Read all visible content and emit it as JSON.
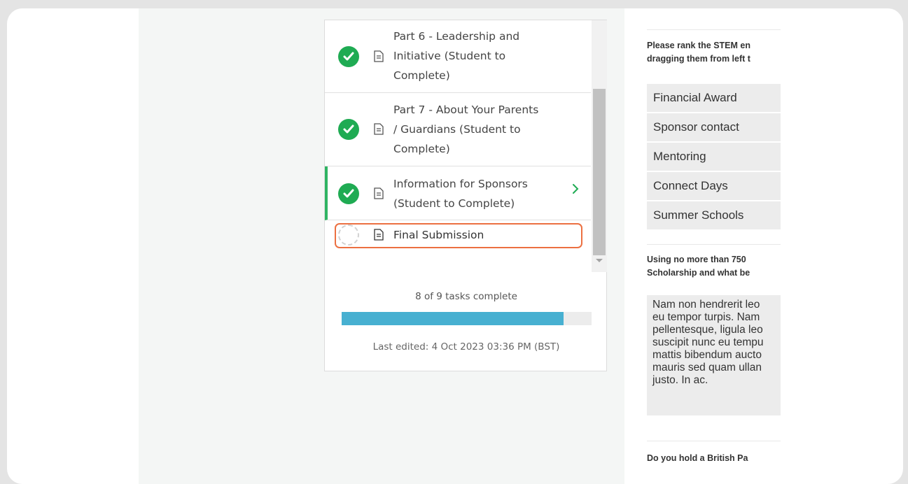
{
  "tasks": [
    {
      "label_lines": [
        "Part 6 - Leadership and",
        "Initiative (Student to",
        "Complete)"
      ],
      "status": "complete"
    },
    {
      "label_lines": [
        "Part 7 - About Your Parents",
        "/ Guardians (Student to",
        "Complete)"
      ],
      "status": "complete"
    },
    {
      "label_lines": [
        "Information for Sponsors",
        "(Student to Complete)"
      ],
      "status": "complete",
      "active": true
    },
    {
      "label_lines": [
        "Final Submission"
      ],
      "status": "pending",
      "highlighted": true
    }
  ],
  "progress": {
    "text": "8 of 9 tasks complete",
    "completed": 8,
    "total": 9,
    "fraction": 0.889,
    "last_edited": "Last edited: 4 Oct 2023 03:36 PM (BST)"
  },
  "form": {
    "question_rank_lines": [
      "Please rank the STEM en",
      "dragging them from left t"
    ],
    "rank_items": [
      "Financial Award",
      "Sponsor contact",
      "Mentoring",
      "Connect Days",
      "Summer Schools"
    ],
    "question_essay_lines": [
      "Using no more than 750",
      "Scholarship and what be"
    ],
    "essay_text": "Nam non hendrerit leo\neu tempor turpis. Nam\npellentesque, ligula leo\nsuscipit nunc eu tempu\nmattis bibendum aucto\nmauris sed quam ullan\njusto. In ac.",
    "question_passport": "Do you hold a British Pa"
  },
  "colors": {
    "check_green": "#1fab53",
    "active_border": "#2fb463",
    "highlight_orange": "#ec7041",
    "progress_blue": "#47b0d1"
  },
  "icons": {
    "complete": "check-circle-icon",
    "document": "document-icon",
    "chevron": "chevron-right-icon",
    "pending": "dashed-circle-icon"
  }
}
